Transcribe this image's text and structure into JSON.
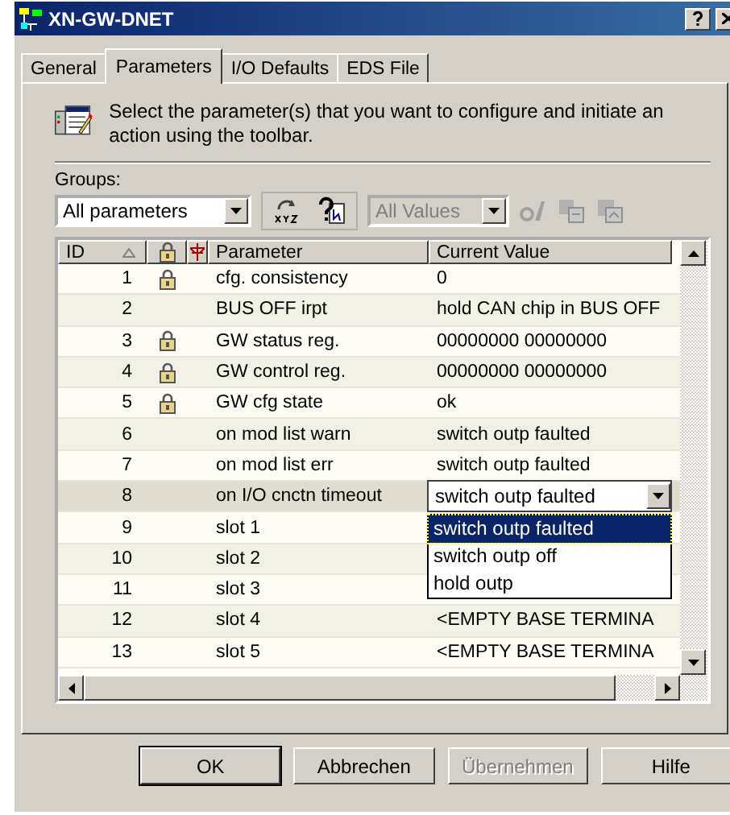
{
  "window": {
    "title": "XN-GW-DNET"
  },
  "tabs": [
    {
      "label": "General",
      "selected": false
    },
    {
      "label": "Parameters",
      "selected": true
    },
    {
      "label": "I/O Defaults",
      "selected": false
    },
    {
      "label": "EDS File",
      "selected": false
    }
  ],
  "description": "Select the parameter(s) that you want to configure and initiate an action using the toolbar.",
  "groups": {
    "label": "Groups:",
    "value": "All parameters"
  },
  "value_filter": {
    "value": "All Values",
    "disabled": true
  },
  "table": {
    "columns": [
      "ID",
      "Parameter",
      "Current Value"
    ],
    "rows": [
      {
        "id": "1",
        "locked": true,
        "parameter": "cfg. consistency",
        "value": "0",
        "selected": false
      },
      {
        "id": "2",
        "locked": false,
        "parameter": "BUS OFF irpt",
        "value": "hold CAN chip in BUS OFF",
        "selected": false
      },
      {
        "id": "3",
        "locked": true,
        "parameter": "GW status reg.",
        "value": "00000000 00000000",
        "selected": false
      },
      {
        "id": "4",
        "locked": true,
        "parameter": "GW control reg.",
        "value": "00000000 00000000",
        "selected": false
      },
      {
        "id": "5",
        "locked": true,
        "parameter": "GW cfg state",
        "value": "ok",
        "selected": false
      },
      {
        "id": "6",
        "locked": false,
        "parameter": "on mod list warn",
        "value": "switch outp faulted",
        "selected": false
      },
      {
        "id": "7",
        "locked": false,
        "parameter": "on mod list err",
        "value": "switch outp faulted",
        "selected": false
      },
      {
        "id": "8",
        "locked": false,
        "parameter": "on I/O cnctn timeout",
        "selected": true,
        "editor": {
          "value": "switch outp faulted",
          "options": [
            {
              "label": "switch outp faulted",
              "selected": true
            },
            {
              "label": "switch outp off",
              "selected": false
            },
            {
              "label": "hold outp",
              "selected": false
            }
          ]
        }
      },
      {
        "id": "9",
        "locked": false,
        "parameter": "slot 1",
        "selected": false
      },
      {
        "id": "10",
        "locked": false,
        "parameter": "slot 2",
        "selected": false
      },
      {
        "id": "11",
        "locked": false,
        "parameter": "slot 3",
        "selected": false
      },
      {
        "id": "12",
        "locked": false,
        "parameter": "slot 4",
        "value": "<EMPTY BASE TERMINA",
        "selected": false
      },
      {
        "id": "13",
        "locked": false,
        "parameter": "slot 5",
        "value": "<EMPTY BASE TERMINA",
        "selected": false
      }
    ]
  },
  "buttons": [
    {
      "label": "OK",
      "disabled": false,
      "default": true
    },
    {
      "label": "Abbrechen",
      "disabled": false,
      "default": false
    },
    {
      "label": "Übernehmen",
      "disabled": true,
      "default": false
    },
    {
      "label": "Hilfe",
      "disabled": false,
      "default": false
    }
  ]
}
